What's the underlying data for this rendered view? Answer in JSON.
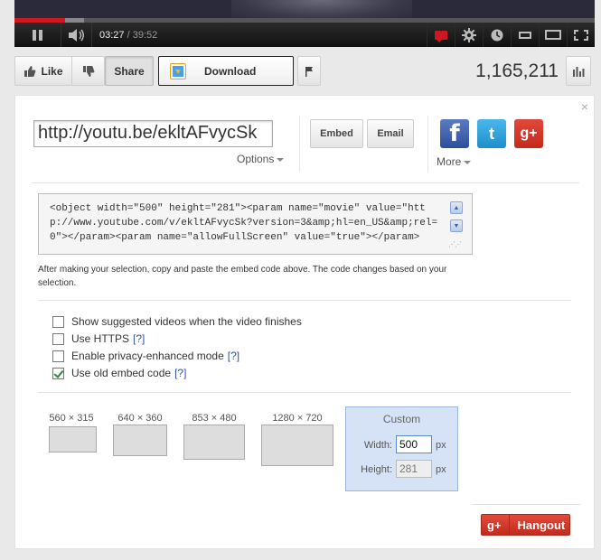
{
  "player": {
    "current_time": "03:27",
    "time_separator": " / ",
    "duration": "39:52",
    "progress_played": 0.087,
    "progress_loaded": 0.12
  },
  "actions": {
    "like_label": "Like",
    "share_label": "Share",
    "download_label": "Download",
    "view_count": "1,165,211"
  },
  "share_panel": {
    "close_symbol": "×",
    "url": "http://youtu.be/ekltAFvycSk",
    "options_label": "Options",
    "embed_label": "Embed",
    "email_label": "Email",
    "more_label": "More",
    "social": {
      "facebook_glyph": "f",
      "twitter_glyph": "t",
      "googleplus_glyph": "g+"
    },
    "embed_code": "<object width=\"500\" height=\"281\"><param name=\"movie\" value=\"http://www.youtube.com/v/ekltAFvycSk?version=3&amp;hl=en_US&amp;rel=0\"></param><param name=\"allowFullScreen\" value=\"true\"></param>",
    "help_text": "After making your selection, copy and paste the embed code above. The code changes based on your selection.",
    "options": [
      {
        "label": "Show suggested videos when the video finishes",
        "checked": false,
        "help": ""
      },
      {
        "label": "Use HTTPS",
        "checked": false,
        "help": "[?]"
      },
      {
        "label": "Enable privacy-enhanced mode",
        "checked": false,
        "help": "[?]"
      },
      {
        "label": "Use old embed code",
        "checked": true,
        "help": "[?]"
      }
    ],
    "sizes": [
      {
        "label": "560 × 315"
      },
      {
        "label": "640 × 360"
      },
      {
        "label": "853 × 480"
      },
      {
        "label": "1280 × 720"
      }
    ],
    "custom": {
      "title": "Custom",
      "width_label": "Width:",
      "width_value": "500",
      "height_label": "Height:",
      "height_value": "281",
      "unit": "px"
    },
    "hangout_label": "Hangout",
    "hangout_glyph": "g+"
  },
  "colors": {
    "progress_red": "#cc181e",
    "hangout_red": "#d03a2c",
    "custom_bg": "#d6e3f6",
    "link_blue": "#2a57a8"
  }
}
